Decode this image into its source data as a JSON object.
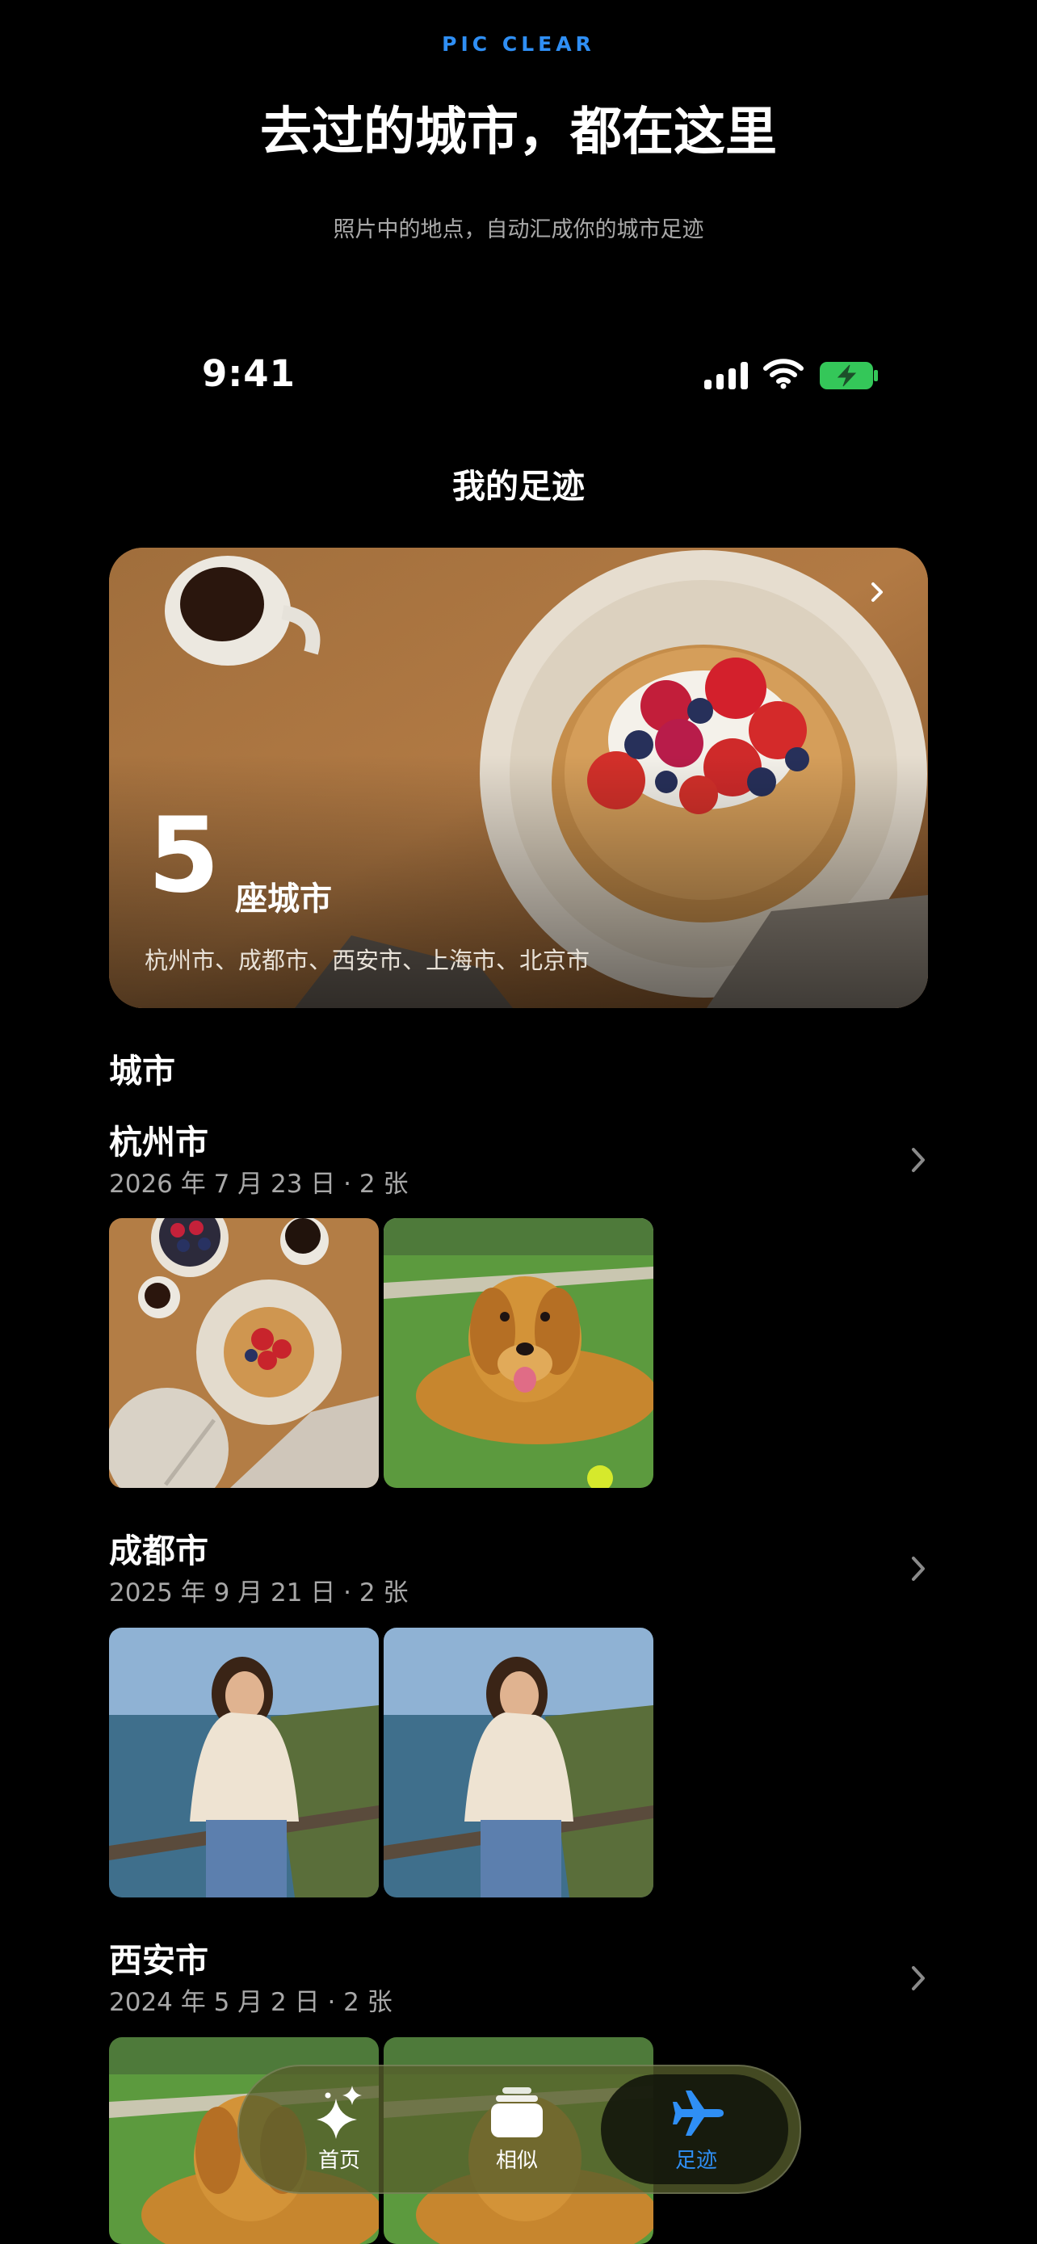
{
  "promo": {
    "brand": "PIC CLEAR",
    "title": "去过的城市，都在这里",
    "subtitle": "照片中的地点，自动汇成你的城市足迹"
  },
  "status_bar": {
    "time": "9:41",
    "icons": [
      "cellular-signal-icon",
      "wifi-icon",
      "battery-charging-icon"
    ],
    "battery_color": "#34c759"
  },
  "nav": {
    "title": "我的足迹"
  },
  "summary_card": {
    "count": "5",
    "unit": "座城市",
    "cities": "杭州市、成都市、西安市、上海市、北京市",
    "photo": "pancake-breakfast-photo"
  },
  "section": {
    "label": "城市"
  },
  "cities": [
    {
      "name": "杭州市",
      "meta": "2026 年 7 月 23 日 · 2 张",
      "photos": [
        "breakfast-table-photo",
        "golden-retriever-photo"
      ]
    },
    {
      "name": "成都市",
      "meta": "2025 年 9 月 21 日 · 2 张",
      "photos": [
        "woman-seaside-photo",
        "woman-seaside-photo"
      ]
    },
    {
      "name": "西安市",
      "meta": "2024 年 5 月 2 日 · 2 张",
      "photos": [
        "golden-retriever-photo",
        "golden-retriever-photo"
      ]
    }
  ],
  "tabbar": {
    "tabs": [
      {
        "label": "首页",
        "icon": "sparkles-icon",
        "active": false
      },
      {
        "label": "相似",
        "icon": "stack-icon",
        "active": false
      },
      {
        "label": "足迹",
        "icon": "airplane-icon",
        "active": true
      }
    ],
    "accent": "#2f8ff5"
  }
}
